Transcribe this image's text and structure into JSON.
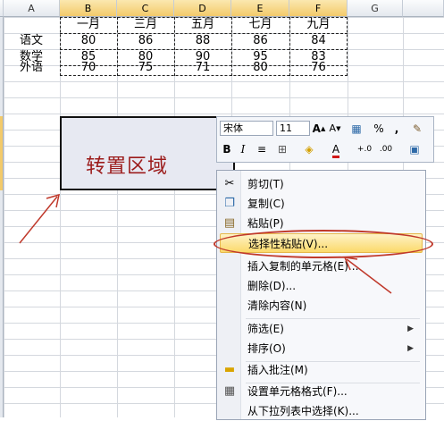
{
  "columns": [
    "A",
    "B",
    "C",
    "D",
    "E",
    "F",
    "G"
  ],
  "selected_columns": [
    "B",
    "C",
    "D",
    "E",
    "F"
  ],
  "table": {
    "header": [
      "",
      "一月",
      "三月",
      "五月",
      "七月",
      "九月"
    ],
    "rows": [
      [
        "语文",
        "80",
        "86",
        "88",
        "86",
        "84"
      ],
      [
        "数学",
        "85",
        "80",
        "90",
        "95",
        "83"
      ],
      [
        "外语",
        "70",
        "75",
        "71",
        "80",
        "76"
      ]
    ]
  },
  "target_area_label": "转置区域",
  "mini_toolbar": {
    "font_name": "宋体",
    "font_size": "11",
    "bold": "B",
    "italic": "I",
    "align": "≡",
    "font_color": "A",
    "percent": "%",
    "comma": ","
  },
  "context_menu": {
    "items": [
      {
        "icon": "scissors-icon",
        "label": "剪切(T)"
      },
      {
        "icon": "copy-icon",
        "label": "复制(C)"
      },
      {
        "icon": "paste-icon",
        "label": "粘贴(P)"
      },
      {
        "icon": "",
        "label": "选择性粘贴(V)...",
        "highlighted": true
      },
      {
        "icon": "",
        "label": "插入复制的单元格(E)..."
      },
      {
        "icon": "",
        "label": "删除(D)..."
      },
      {
        "icon": "",
        "label": "清除内容(N)"
      },
      {
        "icon": "",
        "label": "筛选(E)",
        "submenu": true
      },
      {
        "icon": "",
        "label": "排序(O)",
        "submenu": true
      },
      {
        "icon": "insert-comment-icon",
        "label": "插入批注(M)"
      },
      {
        "icon": "format-cells-icon",
        "label": "设置单元格格式(F)..."
      },
      {
        "icon": "",
        "label": "从下拉列表中选择(K)..."
      }
    ]
  },
  "colors": {
    "annotation": "#c0392b",
    "target_text": "#9c1c1c",
    "highlight": "#fbd96b"
  }
}
